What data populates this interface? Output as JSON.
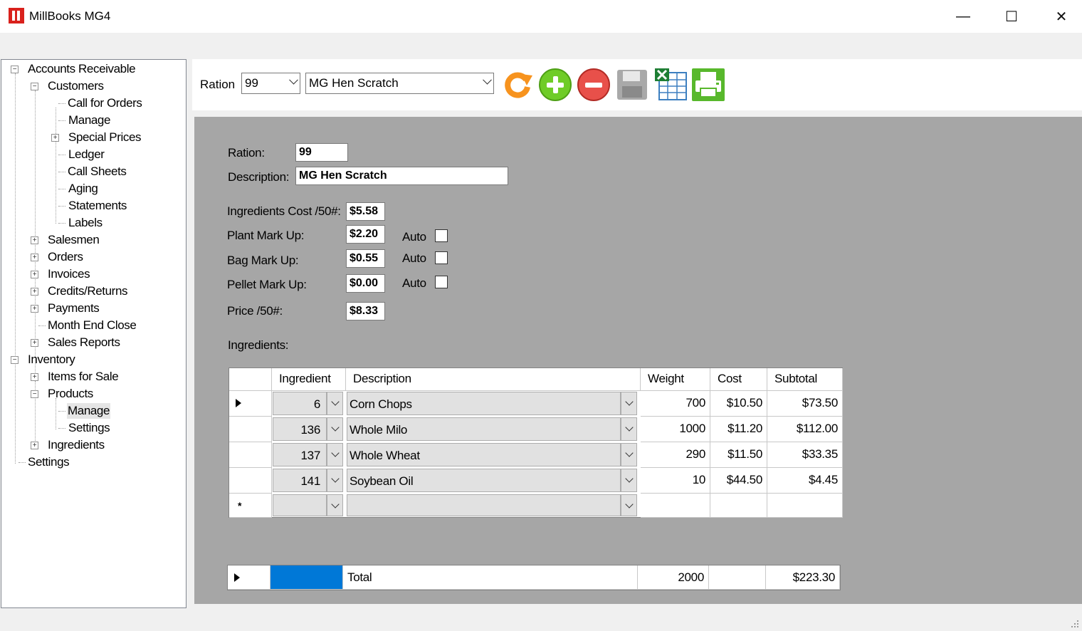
{
  "window": {
    "title": "MillBooks MG4",
    "minimize_glyph": "—",
    "maximize_glyph": "☐",
    "close_glyph": "✕"
  },
  "nav": {
    "accounts_receivable": "Accounts Receivable",
    "customers": "Customers",
    "call_for_orders": "Call for Orders",
    "manage": "Manage",
    "special_prices": "Special Prices",
    "ledger": "Ledger",
    "call_sheets": "Call Sheets",
    "aging": "Aging",
    "statements": "Statements",
    "labels": "Labels",
    "salesmen": "Salesmen",
    "orders": "Orders",
    "invoices": "Invoices",
    "credits_returns": "Credits/Returns",
    "payments": "Payments",
    "month_end_close": "Month End Close",
    "sales_reports": "Sales Reports",
    "inventory": "Inventory",
    "items_for_sale": "Items for Sale",
    "products": "Products",
    "products_manage": "Manage",
    "products_settings": "Settings",
    "ingredients": "Ingredients",
    "settings": "Settings",
    "collapse_glyph": "−",
    "expand_glyph": "+"
  },
  "toolbar": {
    "ration_label": "Ration",
    "ration_value": "99",
    "description_value": "MG Hen Scratch",
    "icons": [
      "refresh-icon",
      "add-icon",
      "remove-icon",
      "save-icon",
      "excel-export-icon",
      "print-icon"
    ]
  },
  "form": {
    "ration_label": "Ration:",
    "ration_value": "99",
    "description_label": "Description:",
    "description_value": "MG Hen Scratch",
    "ingredients_cost_label": "Ingredients Cost /50#:",
    "ingredients_cost_value": "$5.58",
    "plant_markup_label": "Plant Mark Up:",
    "plant_markup_value": "$2.20",
    "bag_markup_label": "Bag Mark Up:",
    "bag_markup_value": "$0.55",
    "pellet_markup_label": "Pellet Mark Up:",
    "pellet_markup_value": "$0.00",
    "price_label": "Price /50#:",
    "price_value": "$8.33",
    "auto_label": "Auto",
    "ingredients_label": "Ingredients:"
  },
  "grid": {
    "headers": [
      "Ingredient",
      "Description",
      "Weight",
      "Cost",
      "Subtotal"
    ],
    "rows": [
      {
        "ingredient": "6",
        "description": "Corn Chops",
        "weight": "700",
        "cost": "$10.50",
        "subtotal": "$73.50"
      },
      {
        "ingredient": "136",
        "description": "Whole Milo",
        "weight": "1000",
        "cost": "$11.20",
        "subtotal": "$112.00"
      },
      {
        "ingredient": "137",
        "description": "Whole Wheat",
        "weight": "290",
        "cost": "$11.50",
        "subtotal": "$33.35"
      },
      {
        "ingredient": "141",
        "description": "Soybean Oil",
        "weight": "10",
        "cost": "$44.50",
        "subtotal": "$4.45"
      }
    ],
    "new_row_marker": "*"
  },
  "totals": {
    "label": "Total",
    "weight": "2000",
    "subtotal": "$223.30"
  },
  "colors": {
    "panel_gray": "#a6a6a6",
    "selection_blue": "#0078d7",
    "accent_orange": "#f7931e",
    "add_green": "#6fcc27",
    "remove_red": "#e8504a"
  }
}
